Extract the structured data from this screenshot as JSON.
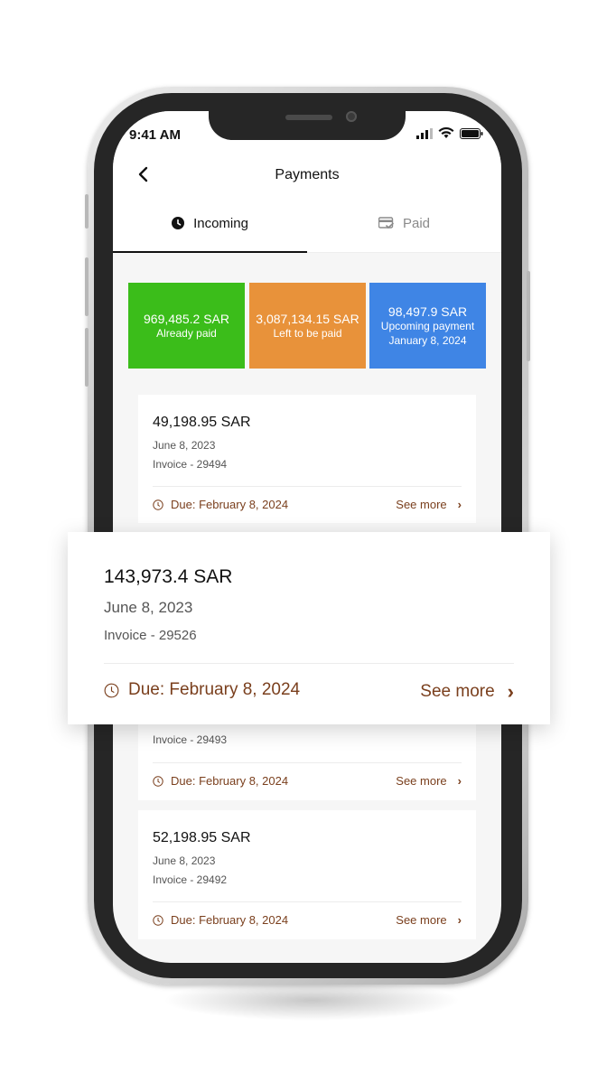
{
  "status_bar": {
    "time": "9:41 AM"
  },
  "header": {
    "title": "Payments",
    "back_icon": "chevron-left-icon"
  },
  "tabs": [
    {
      "label": "Incoming",
      "icon": "clock-icon",
      "active": true
    },
    {
      "label": "Paid",
      "icon": "card-check-icon",
      "active": false
    }
  ],
  "summary": {
    "already_paid": {
      "amount": "969,485.2 SAR",
      "label": "Already paid",
      "color": "#3bbd1a"
    },
    "left_to_pay": {
      "amount": "3,087,134.15 SAR",
      "label": "Left to be paid",
      "color": "#e8923a"
    },
    "upcoming": {
      "amount": "98,497.9 SAR",
      "label": "Upcoming payment",
      "date": "January 8, 2024",
      "color": "#3f85e5"
    }
  },
  "cards": [
    {
      "amount": "49,198.95 SAR",
      "date": "June 8, 2023",
      "invoice": "Invoice - 29494",
      "due": "Due: February 8, 2024",
      "see_more": "See more"
    },
    {
      "amount": "",
      "date": "",
      "invoice": "Invoice - 29493",
      "due": "Due: February 8, 2024",
      "see_more": "See more"
    },
    {
      "amount": "52,198.95 SAR",
      "date": "June 8, 2023",
      "invoice": "Invoice - 29492",
      "due": "Due: February 8, 2024",
      "see_more": "See more"
    }
  ],
  "highlight_card": {
    "amount": "143,973.4 SAR",
    "date": "June 8, 2023",
    "invoice": "Invoice - 29526",
    "due": "Due: February 8, 2024",
    "see_more": "See more"
  },
  "colors": {
    "accent_brown": "#7a3f1d",
    "text_dark": "#111111"
  }
}
